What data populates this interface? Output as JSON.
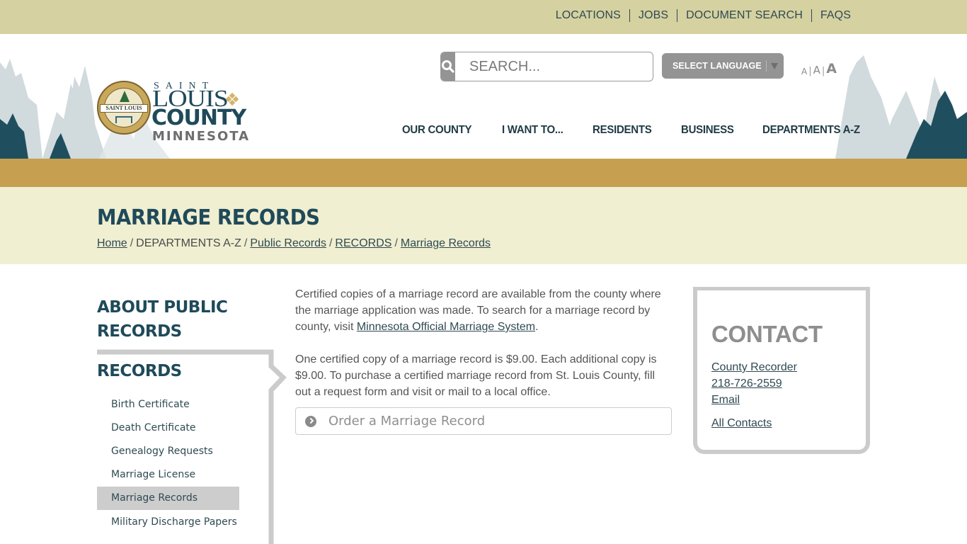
{
  "utility_nav": {
    "items": [
      {
        "label": "LOCATIONS"
      },
      {
        "label": "JOBS"
      },
      {
        "label": "DOCUMENT SEARCH"
      },
      {
        "label": "FAQS"
      }
    ]
  },
  "logo": {
    "seal_text": "SAINT LOUIS",
    "line1": "SAINT",
    "line2": "LOUIS",
    "line3": "COUNTY",
    "line4": "MINNESOTA",
    "alt": "Saint Louis County Minnesota"
  },
  "search": {
    "placeholder": "SEARCH...",
    "value": "",
    "icon": "search-icon"
  },
  "language": {
    "label": "SELECT LANGUAGE",
    "icon": "caret-down-icon"
  },
  "font_sizer": {
    "small": "A",
    "medium": "A",
    "large": "A",
    "separator": "|"
  },
  "main_nav": {
    "items": [
      {
        "label": "OUR COUNTY"
      },
      {
        "label": "I WANT TO..."
      },
      {
        "label": "RESIDENTS"
      },
      {
        "label": "BUSINESS"
      },
      {
        "label": "DEPARTMENTS A-Z"
      }
    ]
  },
  "page": {
    "title": "MARRIAGE RECORDS",
    "breadcrumb": [
      {
        "label": "Home",
        "link": true
      },
      {
        "label": "DEPARTMENTS A-Z",
        "link": false
      },
      {
        "label": "Public Records",
        "link": true
      },
      {
        "label": "RECORDS",
        "link": true
      },
      {
        "label": "Marriage Records",
        "link": true
      }
    ],
    "breadcrumb_separator": "/"
  },
  "sidebar": {
    "parent_heading": "ABOUT PUBLIC RECORDS",
    "section_heading": "RECORDS",
    "items": [
      {
        "label": "Birth Certificate",
        "active": false
      },
      {
        "label": "Death Certificate",
        "active": false
      },
      {
        "label": "Genealogy Requests",
        "active": false
      },
      {
        "label": "Marriage License",
        "active": false
      },
      {
        "label": "Marriage Records",
        "active": true
      },
      {
        "label": "Military Discharge Papers",
        "active": false
      }
    ]
  },
  "content": {
    "para1_before": "Certified copies of a marriage record are available from the county where the marriage application was made. To search for a marriage record by county, visit ",
    "para1_link": "Minnesota Official Marriage System",
    "para1_after": ".",
    "para2": "One certified copy of a marriage record is $9.00. Each additional copy is $9.00. To purchase a certified marriage record from St. Louis County, fill out a request form and visit or mail to a local office.",
    "order_button": {
      "label": "Order a Marriage Record",
      "icon": "chevron-circle-right-icon"
    }
  },
  "contact": {
    "title": "CONTACT",
    "department": "County Recorder",
    "phone": "218-726-2559",
    "email": "Email",
    "all_contacts": "All Contacts"
  },
  "colors": {
    "utility_bar": "#d5d1a0",
    "gold_band": "#c6a050",
    "title_bg": "#f0efd1",
    "brand_teal": "#1f4a5a",
    "gray_button": "#949494",
    "border_gray": "#cbcbcb"
  }
}
